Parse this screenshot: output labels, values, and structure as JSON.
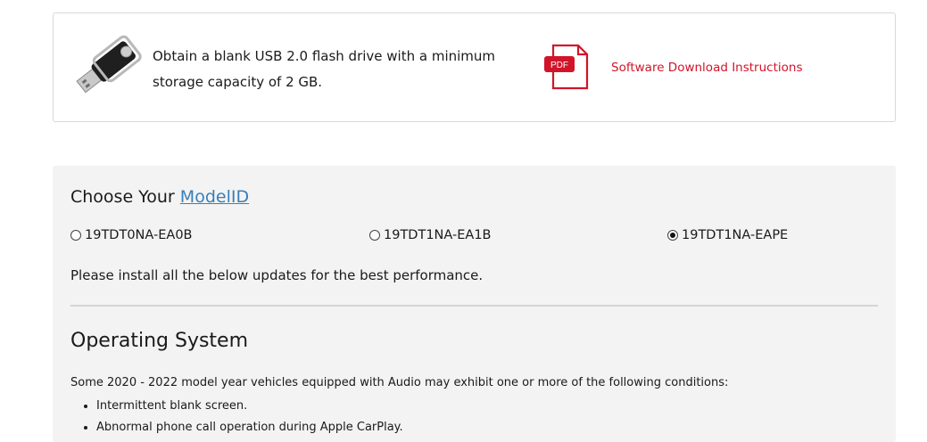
{
  "usb_card": {
    "instruction": "Obtain a blank USB 2.0 flash drive with a minimum storage capacity of 2 GB.",
    "pdf_badge": "PDF",
    "download_link": "Software Download Instructions",
    "icons": [
      "usb-drive-icon",
      "pdf-document-icon"
    ]
  },
  "model_section": {
    "title_prefix": "Choose Your ",
    "title_link": "ModelID",
    "options": [
      {
        "label": "19TDT0NA-EA0B",
        "selected": false
      },
      {
        "label": "19TDT1NA-EA1B",
        "selected": false
      },
      {
        "label": "19TDT1NA-EAPE",
        "selected": true
      }
    ],
    "install_note": "Please install all the below updates for the best performance."
  },
  "os_section": {
    "heading": "Operating System",
    "description": "Some 2020 - 2022 model year vehicles equipped with Audio may exhibit one or more of the following conditions:",
    "conditions": [
      "Intermittent blank screen.",
      "Abnormal phone call operation during Apple CarPlay."
    ]
  },
  "colors": {
    "link_red": "#d2142a",
    "link_blue": "#3a7fb8",
    "panel_bg": "#f3f3f3"
  }
}
